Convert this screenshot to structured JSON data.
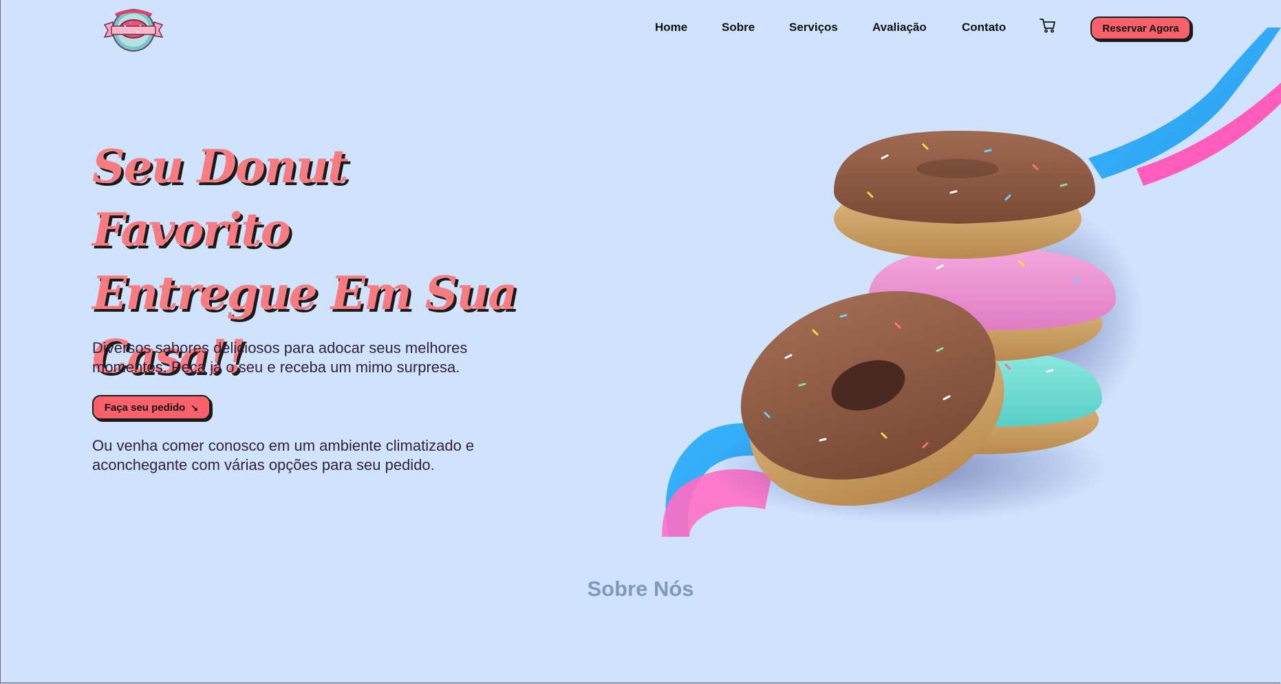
{
  "logo": {
    "alt": "Donut shop logo"
  },
  "nav": {
    "items": [
      {
        "label": "Home"
      },
      {
        "label": "Sobre"
      },
      {
        "label": "Serviços"
      },
      {
        "label": "Avaliação"
      },
      {
        "label": "Contato"
      }
    ],
    "cart_icon": "cart-icon",
    "reserve_label": "Reservar Agora"
  },
  "hero": {
    "title_line1": "Seu Donut Favorito",
    "title_line2": "Entregue Em Sua",
    "title_line3": "Casa!!",
    "description": "Diversos sabores deliciosos para adocar seus melhores momentos. Peça já o seu e receba um mimo surpresa.",
    "order_button": "Faça seu pedido",
    "order_arrow": "↘",
    "description2": "Ou venha comer conosco em um ambiente climatizado e aconchegante com várias opções para seu pedido."
  },
  "about": {
    "title": "Sobre Nós"
  },
  "colors": {
    "background": "#cfe3fd",
    "accent": "#f8606b",
    "title": "#f77c82",
    "section_title": "#7f9ab8"
  }
}
